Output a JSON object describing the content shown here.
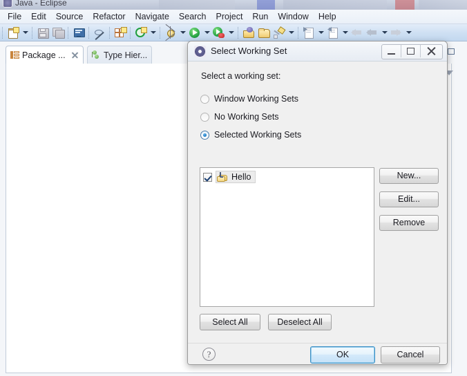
{
  "window": {
    "title": "Java - Eclipse",
    "icon": "eclipse-icon"
  },
  "menubar": {
    "items": [
      {
        "label": "File",
        "name": "menu-file"
      },
      {
        "label": "Edit",
        "name": "menu-edit"
      },
      {
        "label": "Source",
        "name": "menu-source"
      },
      {
        "label": "Refactor",
        "name": "menu-refactor"
      },
      {
        "label": "Navigate",
        "name": "menu-navigate"
      },
      {
        "label": "Search",
        "name": "menu-search"
      },
      {
        "label": "Project",
        "name": "menu-project"
      },
      {
        "label": "Run",
        "name": "menu-run"
      },
      {
        "label": "Window",
        "name": "menu-window"
      },
      {
        "label": "Help",
        "name": "menu-help"
      }
    ]
  },
  "toolbar": {
    "icons": [
      "new-wizard-icon",
      "new-dropdown-arrow",
      "save-icon",
      "save-all-icon",
      "console-icon",
      "toggle-breadcrumb-icon",
      "new-java-package-icon",
      "run-external-tools-icon",
      "external-tools-dropdown-arrow",
      "debug-icon",
      "debug-dropdown-arrow",
      "run-icon",
      "run-dropdown-arrow",
      "coverage-icon",
      "coverage-dropdown-arrow",
      "new-java-project-icon",
      "open-type-icon",
      "search-icon",
      "search-dropdown-arrow",
      "next-annotation-icon",
      "next-annotation-dropdown-arrow",
      "previous-annotation-icon",
      "previous-annotation-dropdown-arrow",
      "back-icon",
      "back-history-icon",
      "back-dropdown-arrow",
      "forward-icon",
      "forward-dropdown-arrow"
    ]
  },
  "view_tabs": [
    {
      "label": "Package ...",
      "name": "tab-package-explorer",
      "active": true,
      "icon": "package-explorer-icon",
      "closable": true
    },
    {
      "label": "Type Hier...",
      "name": "tab-type-hierarchy",
      "active": false,
      "icon": "type-hierarchy-icon",
      "closable": false
    }
  ],
  "view_toolbar": {
    "icons": [
      "collapse-all-icon",
      "link-with-editor-icon",
      "focus-on-active-task-icon",
      "view-menu-icon"
    ]
  },
  "view_controls": {
    "icons": [
      "minimize-view-icon",
      "maximize-view-icon"
    ]
  },
  "dialog": {
    "title": "Select Working Set",
    "icon": "working-set-icon",
    "title_buttons": [
      {
        "name": "dialog-minimize-button",
        "icon": "minimize-icon"
      },
      {
        "name": "dialog-maximize-button",
        "icon": "maximize-icon"
      },
      {
        "name": "dialog-close-button",
        "icon": "close-icon"
      }
    ],
    "prompt": "Select a working set:",
    "radio_options": [
      {
        "label": "Window Working Sets",
        "name": "radio-window-working-sets",
        "selected": false
      },
      {
        "label": "No Working Sets",
        "name": "radio-no-working-sets",
        "selected": false
      },
      {
        "label": "Selected Working Sets",
        "name": "radio-selected-working-sets",
        "selected": true
      }
    ],
    "list_items": [
      {
        "label": "Hello",
        "name": "working-set-hello",
        "checked": true,
        "icon": "working-set-folder-icon",
        "selected": true
      }
    ],
    "side_buttons": [
      {
        "label": "New...",
        "name": "new-button"
      },
      {
        "label": "Edit...",
        "name": "edit-button"
      },
      {
        "label": "Remove",
        "name": "remove-button"
      }
    ],
    "selection_buttons": [
      {
        "label": "Select All",
        "name": "select-all-button"
      },
      {
        "label": "Deselect All",
        "name": "deselect-all-button"
      }
    ],
    "footer": {
      "help_glyph": "?",
      "help_name": "help-icon",
      "ok_label": "OK",
      "cancel_label": "Cancel"
    }
  },
  "colors": {
    "accent_blue": "#3d8fc4",
    "toolbar_blue": "#cfe0f3",
    "dialog_bg": "#f0f0f0",
    "radio_dot": "#1c74bb",
    "folder_yellow": "#f2cf72"
  }
}
